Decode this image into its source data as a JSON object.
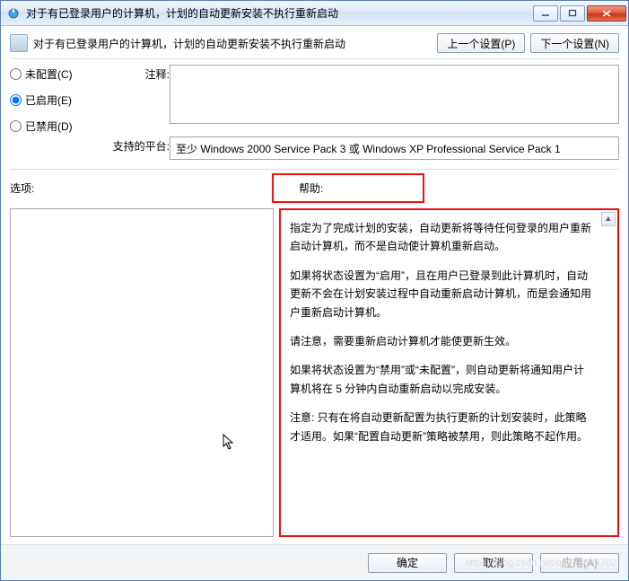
{
  "titlebar": {
    "title": "对于有已登录用户的计算机，计划的自动更新安装不执行重新启动"
  },
  "header": {
    "title": "对于有已登录用户的计算机，计划的自动更新安装不执行重新启动",
    "prev_btn": "上一个设置(P)",
    "next_btn": "下一个设置(N)"
  },
  "radios": {
    "not_configured": "未配置(C)",
    "enabled": "已启用(E)",
    "disabled": "已禁用(D)",
    "selected": "enabled"
  },
  "labels": {
    "comment": "注释:",
    "platform": "支持的平台:",
    "options": "选项:",
    "help": "帮助:"
  },
  "platform_text": "至少 Windows 2000 Service Pack 3 或 Windows XP Professional Service Pack 1",
  "help_paragraphs": [
    "指定为了完成计划的安装，自动更新将等待任何登录的用户重新启动计算机，而不是自动使计算机重新启动。",
    "如果将状态设置为“启用”，且在用户已登录到此计算机时，自动更新不会在计划安装过程中自动重新启动计算机，而是会通知用户重新启动计算机。",
    "请注意，需要重新启动计算机才能使更新生效。",
    "如果将状态设置为“禁用”或“未配置”，则自动更新将通知用户计算机将在 5 分钟内自动重新启动以完成安装。",
    "注意: 只有在将自动更新配置为执行更新的计划安装时，此策略才适用。如果“配置自动更新”策略被禁用，则此策略不起作用。"
  ],
  "footer": {
    "ok": "确定",
    "cancel": "取消",
    "apply": "应用(A)"
  },
  "watermark": "https://blog.csdn.net/qq_42603702"
}
